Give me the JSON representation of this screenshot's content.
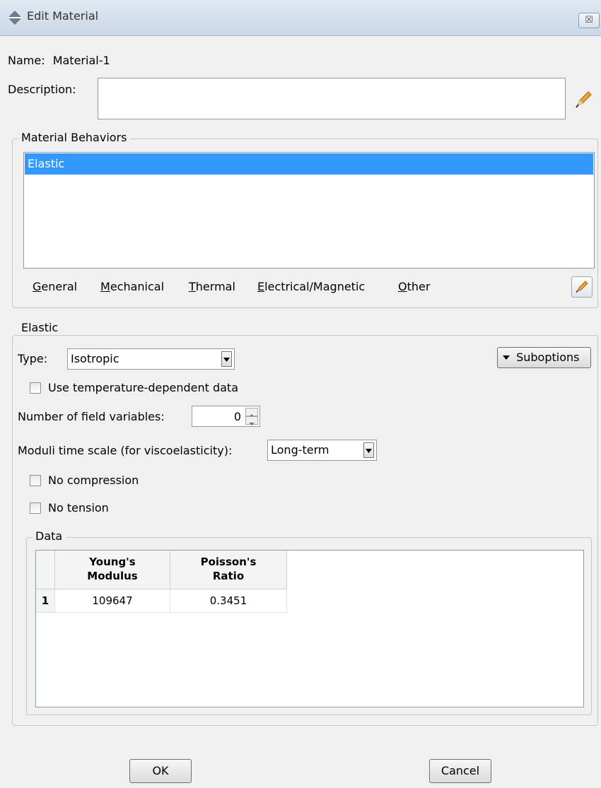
{
  "window": {
    "title": "Edit Material",
    "close_glyph": "☒"
  },
  "name": {
    "label": "Name:",
    "value": "Material-1"
  },
  "description": {
    "label": "Description:",
    "value": ""
  },
  "behaviors": {
    "group_title": "Material Behaviors",
    "items": [
      "Elastic"
    ],
    "menus": [
      {
        "label": "General",
        "accel": "G",
        "rest": "eneral"
      },
      {
        "label": "Mechanical",
        "accel": "M",
        "rest": "echanical"
      },
      {
        "label": "Thermal",
        "accel": "T",
        "rest": "hermal"
      },
      {
        "label": "Electrical/Magnetic",
        "accel": "E",
        "rest": "lectrical/Magnetic"
      },
      {
        "label": "Other",
        "accel": "O",
        "rest": "ther"
      }
    ]
  },
  "elastic": {
    "group_title": "Elastic",
    "type_label": "Type:",
    "type_value": "Isotropic",
    "suboptions_label": "Suboptions",
    "temp_dependent_label": "Use temperature-dependent data",
    "field_vars_label": "Number of field variables:",
    "field_vars_value": "0",
    "moduli_label": "Moduli time scale (for viscoelasticity):",
    "moduli_value": "Long-term",
    "no_compression_label": "No compression",
    "no_tension_label": "No tension"
  },
  "data": {
    "group_title": "Data",
    "columns": [
      {
        "line1": "Young's",
        "line2": "Modulus"
      },
      {
        "line1": "Poisson's",
        "line2": "Ratio"
      }
    ],
    "rows": [
      {
        "index": "1",
        "values": [
          "109647",
          "0.3451"
        ]
      }
    ]
  },
  "footer": {
    "ok_label": "OK",
    "cancel_label": "Cancel"
  },
  "colors": {
    "selection": "#3399ff",
    "background": "#f0f0f0"
  }
}
